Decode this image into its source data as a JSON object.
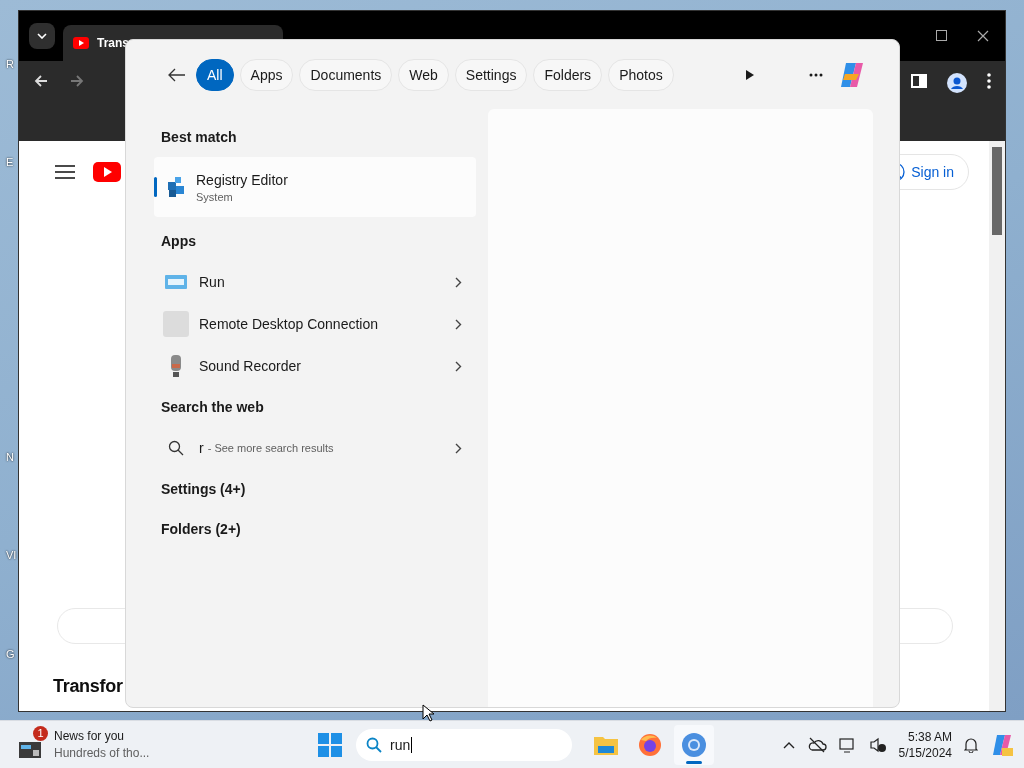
{
  "desktop": {
    "icon_labels": [
      "R",
      "E",
      "N",
      "VI",
      "G"
    ]
  },
  "browser": {
    "tab_title": "Trans",
    "sign_in": "Sign in",
    "heading": "Transfor"
  },
  "search_flyout": {
    "filters": [
      {
        "label": "All",
        "selected": true
      },
      {
        "label": "Apps",
        "selected": false
      },
      {
        "label": "Documents",
        "selected": false
      },
      {
        "label": "Web",
        "selected": false
      },
      {
        "label": "Settings",
        "selected": false
      },
      {
        "label": "Folders",
        "selected": false
      },
      {
        "label": "Photos",
        "selected": false
      }
    ],
    "best_match": {
      "heading": "Best match",
      "title": "Registry Editor",
      "subtitle": "System"
    },
    "apps": {
      "heading": "Apps",
      "items": [
        {
          "kind": "run",
          "name": "Run"
        },
        {
          "kind": "remote",
          "name": "Remote Desktop Connection"
        },
        {
          "kind": "recorder",
          "name": "Sound Recorder"
        }
      ]
    },
    "web": {
      "heading": "Search the web",
      "query": "r",
      "hint": "- See more search results"
    },
    "more": [
      "Settings (4+)",
      "Folders (2+)"
    ]
  },
  "taskbar": {
    "news": {
      "badge": "1",
      "title": "News for you",
      "subtitle": "Hundreds of tho..."
    },
    "search": {
      "value": "run"
    },
    "apps": [
      {
        "kind": "explorer",
        "active": false
      },
      {
        "kind": "firefox",
        "active": false
      },
      {
        "kind": "chrome",
        "active": true
      }
    ],
    "time": "5:38 AM",
    "date": "5/15/2024"
  }
}
